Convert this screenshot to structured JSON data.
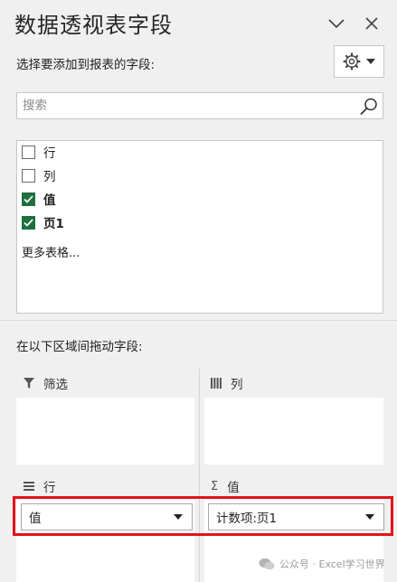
{
  "header": {
    "title": "数据透视表字段",
    "subtitle": "选择要添加到报表的字段:"
  },
  "search": {
    "placeholder": "搜索"
  },
  "fields": [
    {
      "label": "行",
      "checked": false
    },
    {
      "label": "列",
      "checked": false
    },
    {
      "label": "值",
      "checked": true
    },
    {
      "label": "页1",
      "checked": true
    }
  ],
  "more_tables": "更多表格...",
  "drag_hint": "在以下区域间拖动字段:",
  "areas": {
    "filter": {
      "label": "筛选"
    },
    "columns": {
      "label": "列"
    },
    "rows": {
      "label": "行",
      "item": "值"
    },
    "values": {
      "label": "值",
      "sigma": "Σ",
      "item": "计数项:页1"
    }
  },
  "watermark": "公众号 · Excel学习世界",
  "colors": {
    "checkbox_checked": "#1e6f3e",
    "highlight": "#e3121b"
  }
}
